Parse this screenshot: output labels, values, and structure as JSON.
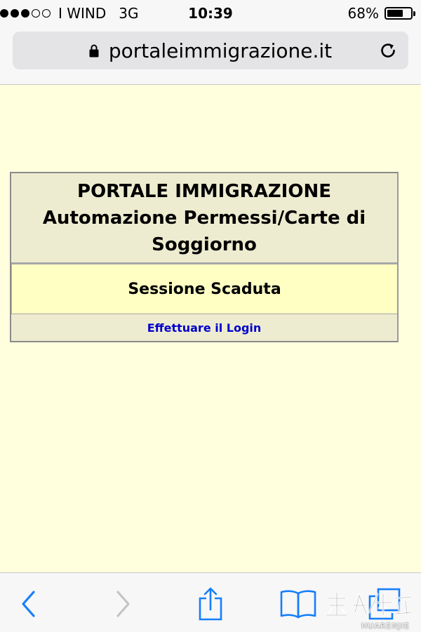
{
  "status_bar": {
    "signal_filled": 3,
    "signal_total": 5,
    "carrier": "I WIND",
    "network": "3G",
    "time": "10:39",
    "battery_percent_label": "68%",
    "battery_level": 0.68
  },
  "browser": {
    "url": "portaleimmigrazione.it",
    "secure": true,
    "lock_icon": "lock-icon",
    "reload_icon": "reload-icon"
  },
  "page": {
    "background_color": "#ffffde",
    "header_lines": [
      "PORTALE IMMIGRAZIONE",
      "Automazione Permessi/Carte di",
      "Soggiorno"
    ],
    "message": "Sessione Scaduta",
    "login_link": "Effettuare il Login",
    "link_color": "#0000cc"
  },
  "toolbar": {
    "back_icon": "chevron-left-icon",
    "forward_icon": "chevron-right-icon",
    "share_icon": "share-icon",
    "bookmarks_icon": "bookmarks-book-icon",
    "tabs_icon": "tabs-icon",
    "accent_color": "#157efb",
    "disabled_color": "#c4c4c6"
  },
  "watermark": {
    "brand": "HUARENJIE"
  }
}
